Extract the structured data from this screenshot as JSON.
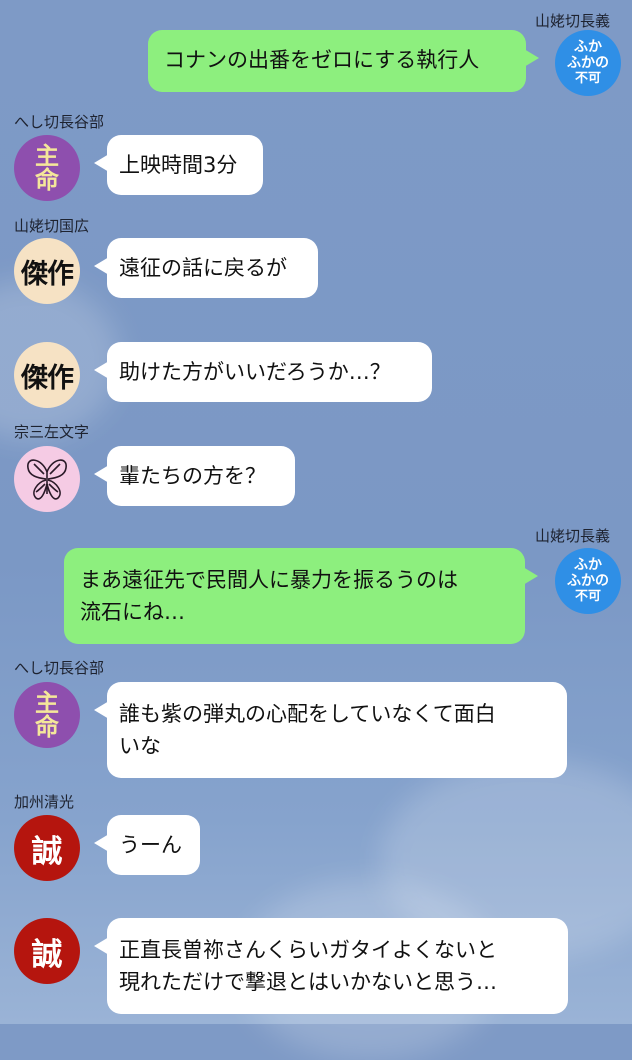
{
  "chat": {
    "messages": [
      {
        "side": "right",
        "sender": "山姥切長義",
        "avatar": {
          "type": "fuka",
          "lines": [
            "ふか",
            "ふかの",
            "不可"
          ]
        },
        "text": "コナンの出番をゼロにする執行人"
      },
      {
        "side": "left",
        "sender": "へし切長谷部",
        "avatar": {
          "type": "shu",
          "lines": [
            "主",
            "命"
          ]
        },
        "text": "上映時間3分"
      },
      {
        "side": "left",
        "sender": "山姥切国広",
        "avatar": {
          "type": "kes",
          "lines": [
            "傑作"
          ]
        },
        "text": "遠征の話に戻るが"
      },
      {
        "side": "left",
        "sender": "",
        "avatar": {
          "type": "kes",
          "lines": [
            "傑作"
          ]
        },
        "text": "助けた方がいいだろうか…？"
      },
      {
        "side": "left",
        "sender": "宗三左文字",
        "avatar": {
          "type": "butterfly",
          "lines": []
        },
        "text": "輩たちの方を？"
      },
      {
        "side": "right",
        "sender": "山姥切長義",
        "avatar": {
          "type": "fuka",
          "lines": [
            "ふか",
            "ふかの",
            "不可"
          ]
        },
        "text": "まあ遠征先で民間人に暴力を振るうのは\n流石にね…"
      },
      {
        "side": "left",
        "sender": "へし切長谷部",
        "avatar": {
          "type": "shu",
          "lines": [
            "主",
            "命"
          ]
        },
        "text": "誰も紫の弾丸の心配をしていなくて面白\nいな"
      },
      {
        "side": "left",
        "sender": "加州清光",
        "avatar": {
          "type": "sei",
          "lines": [
            "誠"
          ]
        },
        "text": "うーん"
      },
      {
        "side": "left",
        "sender": "",
        "avatar": {
          "type": "sei",
          "lines": [
            "誠"
          ]
        },
        "text": "正直長曽祢さんくらいガタイよくないと\n現れただけで撃退とはいかないと思う…"
      }
    ]
  },
  "colors": {
    "background": "#7b98c5",
    "bubble_left": "#ffffff",
    "bubble_right": "#8def7e",
    "avatar_purple": "#8e4fae",
    "avatar_blue": "#2f8fe6",
    "avatar_red": "#b5150e",
    "avatar_cream": "#f6e2c4",
    "avatar_pink": "#f5cbe4"
  }
}
